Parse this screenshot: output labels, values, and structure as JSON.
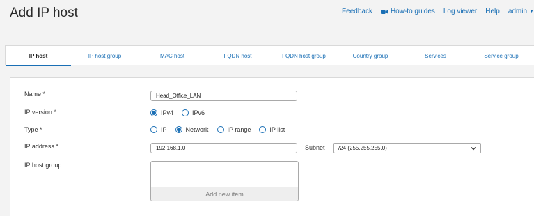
{
  "page": {
    "title": "Add IP host"
  },
  "top_nav": {
    "feedback": "Feedback",
    "how_to": "How-to guides",
    "log_viewer": "Log viewer",
    "help": "Help",
    "user": "admin",
    "how_to_icon": "video-camera-icon"
  },
  "tabs": [
    {
      "label": "IP host",
      "active": true
    },
    {
      "label": "IP host group",
      "active": false
    },
    {
      "label": "MAC host",
      "active": false
    },
    {
      "label": "FQDN host",
      "active": false
    },
    {
      "label": "FQDN host group",
      "active": false
    },
    {
      "label": "Country group",
      "active": false
    },
    {
      "label": "Services",
      "active": false
    },
    {
      "label": "Service group",
      "active": false
    }
  ],
  "form": {
    "name": {
      "label": "Name *",
      "value": "Head_Office_LAN"
    },
    "ip_version": {
      "label": "IP version *",
      "options": [
        "IPv4",
        "IPv6"
      ],
      "selected": "IPv4"
    },
    "type": {
      "label": "Type *",
      "options": [
        "IP",
        "Network",
        "IP range",
        "IP list"
      ],
      "selected": "Network"
    },
    "ip_address": {
      "label": "IP address *",
      "value": "192.168.1.0"
    },
    "subnet": {
      "label": "Subnet",
      "value": "/24 (255.255.255.0)"
    },
    "ip_host_group": {
      "label": "IP host group",
      "add_item": "Add new item"
    }
  },
  "colors": {
    "accent": "#1a6fb5",
    "background": "#f3f3f3",
    "panel": "#ffffff"
  }
}
